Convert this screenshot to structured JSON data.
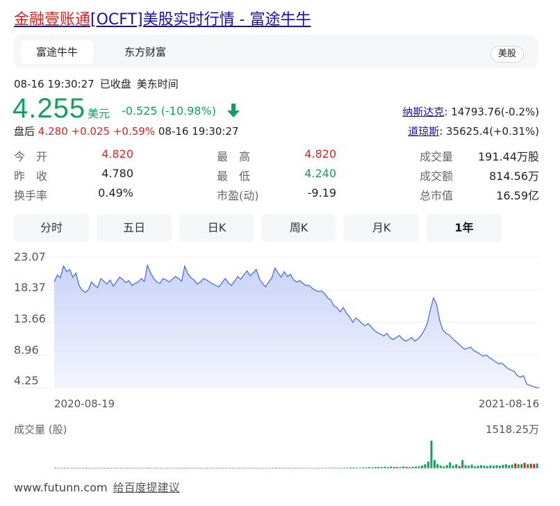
{
  "page": {
    "title_highlight": "金融壹账通",
    "title_rest": "[OCFT]美股实时行情 - 富途牛牛"
  },
  "source_tabs": [
    {
      "label": "富途牛牛",
      "active": true
    },
    {
      "label": "东方财富",
      "active": false
    }
  ],
  "market_badge": "美股",
  "status": {
    "datetime": "08-16 19:30:27",
    "state": "已收盘",
    "timezone": "美东时间"
  },
  "quote": {
    "price": "4.255",
    "currency": "美元",
    "change": "-0.525 (-10.98%)",
    "direction": "down",
    "color_down": "#14a05a",
    "color_up": "#e02020"
  },
  "after_hours": {
    "label": "盘后",
    "price": "4.280",
    "change": "+0.025",
    "percent": "+0.59%",
    "datetime": "08-16 19:30:27"
  },
  "indices": [
    {
      "name": "纳斯达克",
      "value": ": 14793.76(-0.2%)"
    },
    {
      "name": "道琼斯",
      "value": ": 35625.4(+0.31%)"
    }
  ],
  "stats": [
    {
      "label": "今　开",
      "value": "4.820",
      "color": "red"
    },
    {
      "label": "最　高",
      "value": "4.820",
      "color": "red"
    },
    {
      "label": "成交量",
      "value": "191.44万股",
      "color": "normal"
    },
    {
      "label": "昨　收",
      "value": "4.780",
      "color": "normal"
    },
    {
      "label": "最　低",
      "value": "4.240",
      "color": "green"
    },
    {
      "label": "成交额",
      "value": "814.56万",
      "color": "normal"
    },
    {
      "label": "换手率",
      "value": "0.49%",
      "color": "normal"
    },
    {
      "label": "市盈(动)",
      "value": "-9.19",
      "color": "normal"
    },
    {
      "label": "总市值",
      "value": "16.59亿",
      "color": "normal"
    }
  ],
  "period_tabs": [
    {
      "label": "分时",
      "active": false
    },
    {
      "label": "五日",
      "active": false
    },
    {
      "label": "日K",
      "active": false
    },
    {
      "label": "周K",
      "active": false
    },
    {
      "label": "月K",
      "active": false
    },
    {
      "label": "1年",
      "active": true
    }
  ],
  "chart_data": {
    "type": "area",
    "y_ticks": [
      "23.07",
      "18.37",
      "13.66",
      "8.96",
      "4.25"
    ],
    "ylim": [
      4.25,
      23.07
    ],
    "x_start": "2020-08-19",
    "x_end": "2021-08-16",
    "grid": true,
    "line_color": "#4a6fe0",
    "fill_color": "#dfe5fb",
    "series": [
      {
        "values": [
          19.5,
          20.5,
          20.1,
          21.8,
          21.0,
          21.3,
          20.2,
          20.8,
          19.0,
          18.3,
          18.0,
          18.4,
          19.5,
          19.0,
          18.7,
          20.0,
          19.6,
          19.2,
          19.8,
          18.9,
          19.5,
          20.2,
          19.9,
          19.4,
          19.7,
          19.0,
          19.3,
          19.5,
          20.0,
          19.6,
          21.9,
          20.8,
          20.0,
          19.5,
          19.3,
          20.0,
          19.8,
          19.5,
          19.9,
          20.3,
          20.0,
          19.6,
          21.8,
          20.7,
          20.1,
          19.8,
          19.2,
          19.5,
          20.0,
          19.8,
          19.5,
          19.2,
          19.0,
          18.8,
          19.4,
          20.0,
          19.4,
          19.0,
          19.6,
          20.3,
          19.9,
          20.5,
          21.1,
          20.4,
          20.8,
          21.3,
          20.0,
          19.3,
          18.8,
          19.5,
          20.1,
          21.5,
          20.8,
          20.2,
          21.0,
          20.3,
          20.6,
          19.8,
          19.5,
          19.7,
          19.3,
          19.0,
          19.0,
          18.6,
          18.3,
          18.1,
          18.2,
          17.8,
          17.2,
          16.9,
          16.0,
          15.8,
          15.2,
          15.8,
          15.0,
          14.5,
          13.7,
          14.3,
          14.0,
          13.5,
          13.2,
          13.5,
          13.0,
          12.5,
          12.2,
          12.0,
          11.7,
          12.1,
          11.5,
          11.2,
          11.5,
          11.8,
          11.3,
          11.0,
          11.2,
          11.5,
          11.0,
          11.3,
          11.8,
          12.5,
          13.5,
          15.5,
          17.2,
          16.3,
          14.0,
          12.6,
          12.1,
          11.9,
          11.4,
          11.0,
          10.6,
          10.2,
          9.8,
          10.0,
          10.1,
          9.6,
          9.4,
          9.1,
          8.8,
          9.0,
          8.6,
          8.3,
          8.0,
          7.7,
          7.8,
          7.4,
          7.0,
          6.8,
          6.6,
          6.0,
          5.8,
          6.0,
          4.8,
          4.6,
          4.45,
          4.3,
          4.255
        ]
      }
    ],
    "volume_title": "成交量 (股)",
    "volume_max": "1518.25万",
    "volume_colors": {
      "up": "#e02020",
      "down": "#14a05a"
    },
    "volume": [
      0.03,
      0.02,
      0.02,
      0.03,
      0.02,
      0.02,
      0.02,
      0.02,
      0.02,
      0.02,
      0.03,
      0.02,
      0.02,
      0.02,
      0.02,
      0.02,
      0.02,
      0.02,
      0.02,
      0.02,
      0.02,
      0.02,
      0.02,
      0.02,
      0.02,
      0.02,
      0.02,
      0.02,
      0.02,
      0.02,
      0.03,
      0.02,
      0.02,
      0.02,
      0.02,
      0.02,
      0.02,
      0.02,
      0.02,
      0.02,
      0.02,
      0.02,
      0.03,
      0.02,
      0.02,
      0.02,
      0.02,
      0.02,
      0.02,
      0.02,
      0.02,
      0.02,
      0.02,
      0.02,
      0.02,
      0.02,
      0.02,
      0.02,
      0.02,
      0.02,
      0.02,
      0.02,
      0.02,
      0.02,
      0.02,
      0.02,
      0.02,
      0.02,
      0.02,
      0.02,
      0.02,
      0.03,
      0.02,
      0.02,
      0.02,
      0.02,
      0.02,
      0.02,
      0.02,
      0.02,
      0.02,
      0.02,
      0.02,
      0.02,
      0.02,
      0.02,
      0.02,
      0.02,
      0.02,
      0.03,
      0.03,
      0.02,
      0.03,
      0.03,
      0.03,
      0.04,
      0.04,
      0.03,
      0.03,
      0.04,
      0.04,
      0.05,
      0.04,
      0.05,
      0.06,
      0.05,
      0.06,
      0.05,
      0.07,
      0.05,
      0.06,
      0.05,
      0.07,
      0.06,
      0.05,
      0.06,
      0.07,
      0.08,
      0.1,
      0.15,
      0.25,
      1.0,
      0.3,
      0.15,
      0.1,
      0.08,
      0.12,
      0.22,
      0.1,
      0.15,
      0.09,
      0.3,
      0.12,
      0.1,
      0.14,
      0.08,
      0.1,
      0.12,
      0.1,
      0.09,
      0.11,
      0.1,
      0.12,
      0.1,
      0.13,
      0.15,
      0.12,
      0.14,
      0.18,
      0.15,
      0.16,
      0.2,
      0.15,
      0.17,
      0.16,
      0.18
    ],
    "volume_dirs": "dudduduudduudduduuddudduduuddduduudddudduudddduduudduddudduduudduddduduuddudddddddddudddddddddddddddddddddddduddduddddddddddddddddudddddddddddddddd"
  },
  "footer": {
    "domain": "www.futunn.com",
    "feedback": "给百度提建议"
  }
}
